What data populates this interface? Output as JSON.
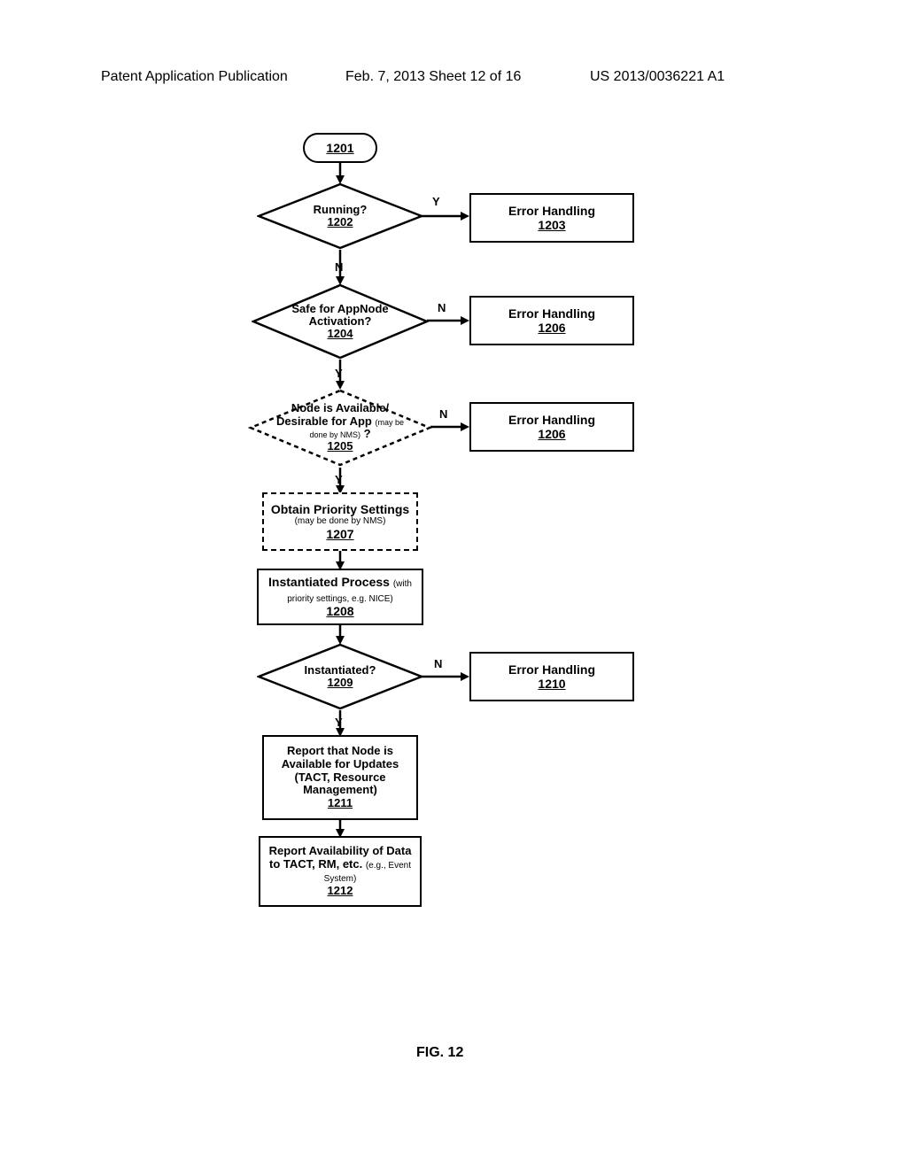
{
  "header": {
    "left": "Patent Application Publication",
    "center": "Feb. 7, 2013 Sheet 12 of 16",
    "right": "US 2013/0036221 A1"
  },
  "figure_label": "FIG. 12",
  "nodes": {
    "start": {
      "ref": "1201"
    },
    "running": {
      "label": "Running?",
      "ref": "1202"
    },
    "err1203": {
      "label": "Error Handling",
      "ref": "1203"
    },
    "safe": {
      "label_line1": "Safe for AppNode",
      "label_line2": "Activation?",
      "ref": "1204"
    },
    "err1206a": {
      "label": "Error Handling",
      "ref": "1206"
    },
    "nodeAvail": {
      "label_line1": "Node is Available/",
      "label_line2": "Desirable for App",
      "label_small": "(may be done by NMS)",
      "q": "?",
      "ref": "1205"
    },
    "err1206b": {
      "label": "Error Handling",
      "ref": "1206"
    },
    "obtainPriority": {
      "label": "Obtain Priority Settings",
      "small": "(may be done by NMS)",
      "ref": "1207"
    },
    "instProcess": {
      "label": "Instantiated Process",
      "small": "(with priority settings, e.g. NICE)",
      "ref": "1208"
    },
    "instantiated": {
      "label": "Instantiated?",
      "ref": "1209"
    },
    "err1210": {
      "label": "Error Handling",
      "ref": "1210"
    },
    "reportNode": {
      "l1": "Report that Node is",
      "l2": "Available for Updates",
      "l3": "(TACT, Resource",
      "l4": "Management)",
      "ref": "1211"
    },
    "reportData": {
      "l1": "Report Availability of Data",
      "l2": "to TACT, RM, etc.",
      "small": "(e.g., Event System)",
      "ref": "1212"
    }
  },
  "edges": {
    "y": "Y",
    "n": "N"
  },
  "chart_data": {
    "type": "flowchart",
    "title": "FIG. 12",
    "nodes": [
      {
        "id": "1201",
        "type": "terminator",
        "label": "1201"
      },
      {
        "id": "1202",
        "type": "decision",
        "label": "Running?"
      },
      {
        "id": "1203",
        "type": "process",
        "label": "Error Handling"
      },
      {
        "id": "1204",
        "type": "decision",
        "label": "Safe for AppNode Activation?"
      },
      {
        "id": "1206a",
        "type": "process",
        "label": "Error Handling (1206)"
      },
      {
        "id": "1205",
        "type": "decision",
        "label": "Node is Available/Desirable for App (may be done by NMS)?",
        "style": "dashed"
      },
      {
        "id": "1206b",
        "type": "process",
        "label": "Error Handling (1206)"
      },
      {
        "id": "1207",
        "type": "process",
        "label": "Obtain Priority Settings (may be done by NMS)",
        "style": "dashed"
      },
      {
        "id": "1208",
        "type": "process",
        "label": "Instantiated Process (with priority settings, e.g. NICE)"
      },
      {
        "id": "1209",
        "type": "decision",
        "label": "Instantiated?"
      },
      {
        "id": "1210",
        "type": "process",
        "label": "Error Handling"
      },
      {
        "id": "1211",
        "type": "process",
        "label": "Report that Node is Available for Updates (TACT, Resource Management)"
      },
      {
        "id": "1212",
        "type": "process",
        "label": "Report Availability of Data to TACT, RM, etc. (e.g., Event System)"
      }
    ],
    "edges": [
      {
        "from": "1201",
        "to": "1202"
      },
      {
        "from": "1202",
        "to": "1203",
        "label": "Y"
      },
      {
        "from": "1202",
        "to": "1204",
        "label": "N"
      },
      {
        "from": "1204",
        "to": "1206a",
        "label": "N"
      },
      {
        "from": "1204",
        "to": "1205",
        "label": "Y"
      },
      {
        "from": "1205",
        "to": "1206b",
        "label": "N"
      },
      {
        "from": "1205",
        "to": "1207",
        "label": "Y"
      },
      {
        "from": "1207",
        "to": "1208"
      },
      {
        "from": "1208",
        "to": "1209"
      },
      {
        "from": "1209",
        "to": "1210",
        "label": "N"
      },
      {
        "from": "1209",
        "to": "1211",
        "label": "Y"
      },
      {
        "from": "1211",
        "to": "1212"
      }
    ]
  }
}
